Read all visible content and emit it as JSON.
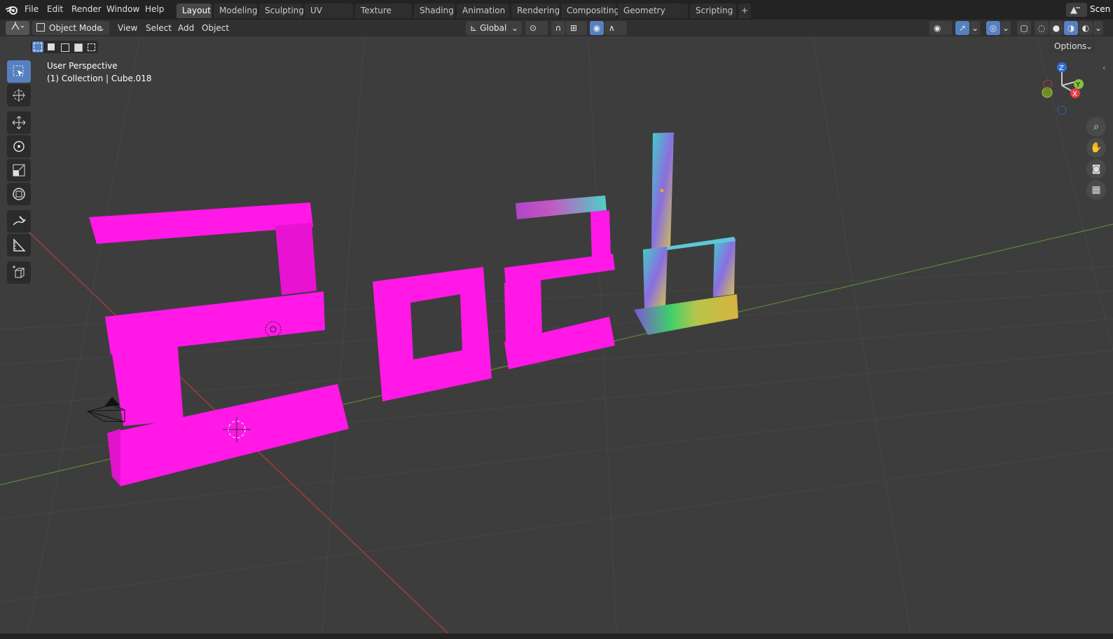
{
  "menu": {
    "file": "File",
    "edit": "Edit",
    "render": "Render",
    "window": "Window",
    "help": "Help"
  },
  "workspaces": [
    "Layout",
    "Modeling",
    "Sculpting",
    "UV Editing",
    "Texture Paint",
    "Shading",
    "Animation",
    "Rendering",
    "Compositing",
    "Geometry Nodes",
    "Scripting"
  ],
  "scene_label": "Scen",
  "header": {
    "mode": "Object Mode",
    "view": "View",
    "select": "Select",
    "add": "Add",
    "object": "Object",
    "orientation": "Global"
  },
  "viewport": {
    "perspective": "User Perspective",
    "collection": "(1) Collection | Cube.018",
    "options": "Options"
  },
  "gizmo": {
    "z": "Z",
    "y": "Y",
    "x": "X"
  },
  "colors": {
    "accent": "#5680c2",
    "magenta": "#ff18e6",
    "viewport_bg": "#3d3d3d"
  }
}
